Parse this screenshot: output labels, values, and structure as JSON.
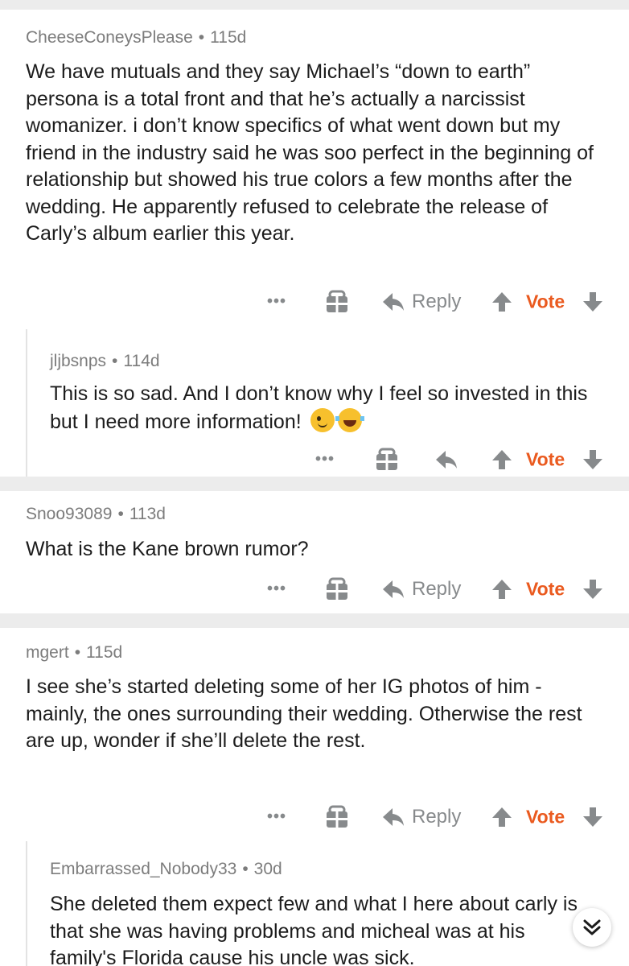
{
  "comments": [
    {
      "author": "CheeseConeysPlease",
      "age": "115d",
      "body": "We have mutuals and they say Michael’s “down to earth” persona is a total front and that he’s actually a narcissist womanizer. i don’t know specifics of what went down but my friend in the industry said he was soo perfect in the beginning of relationship but showed his true colors a few months after the wedding. He apparently refused to celebrate the release of Carly’s album earlier this year.",
      "reply_label": "Reply",
      "vote_label": "Vote"
    },
    {
      "author": "jljbsnps",
      "age": "114d",
      "body": "This is so sad.  And I don’t know why I feel so invested in this but I need more information!",
      "emojis": [
        "winking-face",
        "face-with-tears-of-joy"
      ],
      "vote_label": "Vote"
    },
    {
      "author": "Snoo93089",
      "age": "113d",
      "body": "What is the Kane brown rumor?",
      "reply_label": "Reply",
      "vote_label": "Vote"
    },
    {
      "author": "mgert",
      "age": "115d",
      "body": "I see she’s started deleting some of her IG photos of him - mainly, the ones surrounding their wedding. Otherwise the rest are up, wonder if she’ll delete the rest.",
      "reply_label": "Reply",
      "vote_label": "Vote"
    },
    {
      "author": "Embarrassed_Nobody33",
      "age": "30d",
      "body": "She deleted them expect few and what I here about carly is that she was having problems and micheal was at his family's Florida cause his uncle was sick."
    }
  ],
  "meta_separator": "•",
  "more_label": "•••",
  "icons": {
    "more": "more-options-icon",
    "award": "award-gift-icon",
    "reply": "reply-arrow-icon",
    "upvote": "upvote-arrow-icon",
    "downvote": "downvote-arrow-icon",
    "scroll": "double-chevron-down-icon"
  },
  "colors": {
    "vote": "#ea5a1f",
    "meta": "#7c7c7c",
    "icon": "#878a8c",
    "separator": "#ececec"
  }
}
